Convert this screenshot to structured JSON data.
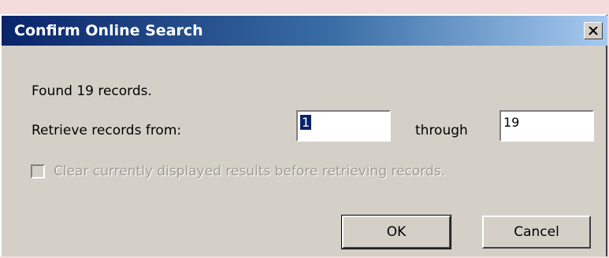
{
  "window": {
    "title": "Confirm Online Search",
    "close_icon": "close-icon"
  },
  "dialog": {
    "found_text": "Found 19 records.",
    "retrieve_label": "Retrieve records from:",
    "from_value": "1",
    "through_label": "through",
    "to_value": "19",
    "clear_checkbox": {
      "label": "Clear currently displayed results before retrieving records.",
      "checked": false,
      "enabled": false
    },
    "ok_label": "OK",
    "cancel_label": "Cancel"
  },
  "colors": {
    "title_start": "#0a246a",
    "title_end": "#a6caf0",
    "dialog_bg": "#d4d0c8",
    "page_bg": "#f4dcdc"
  }
}
